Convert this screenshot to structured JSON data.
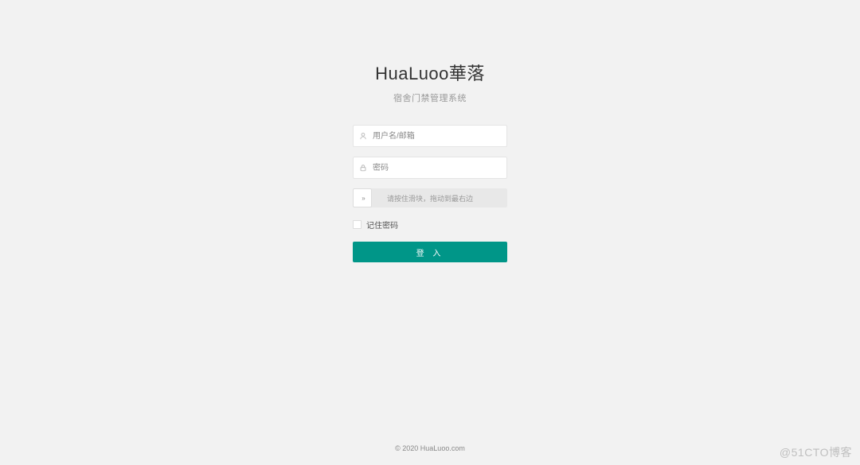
{
  "header": {
    "title": "HuaLuoo華落",
    "subtitle": "宿舍门禁管理系统"
  },
  "form": {
    "username_placeholder": "用户名/邮箱",
    "password_placeholder": "密码",
    "slider_text": "请按住滑块，拖动到最右边",
    "remember_label": "记住密码",
    "login_label": "登 入"
  },
  "footer": {
    "copyright": "© 2020   HuaLuoo.com"
  },
  "watermark": "@51CTO博客",
  "colors": {
    "primary": "#009688",
    "background": "#f2f2f2"
  }
}
